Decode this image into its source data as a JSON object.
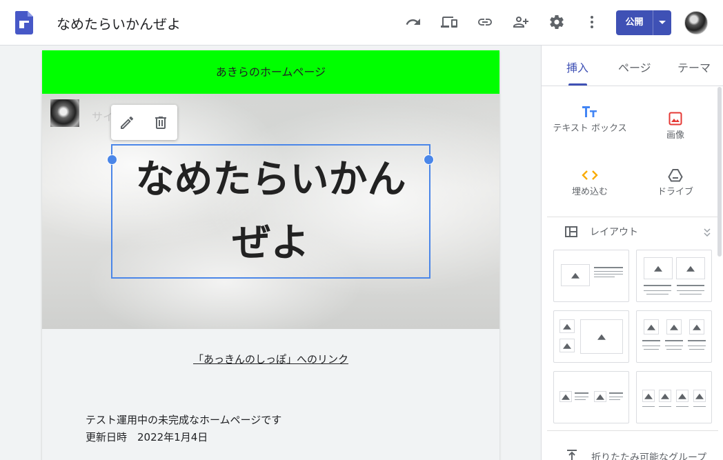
{
  "app": {
    "title": "なめたらいかんぜよ",
    "publish_label": "公開"
  },
  "site": {
    "header_title": "あきらのホームページ",
    "site_name_placeholder": "サイ",
    "hero_title": "なめたらいかんぜよ",
    "link_text": "「あっきんのしっぽ」へのリンク",
    "body_line1": "テスト運用中の未完成なホームページです",
    "body_line2": "更新日時　2022年1月4日"
  },
  "panel": {
    "tabs": [
      "挿入",
      "ページ",
      "テーマ"
    ],
    "insert_items": [
      {
        "label": "テキスト ボックス",
        "icon": "text-box-icon"
      },
      {
        "label": "画像",
        "icon": "image-icon"
      },
      {
        "label": "埋め込む",
        "icon": "embed-icon"
      },
      {
        "label": "ドライブ",
        "icon": "drive-icon"
      }
    ],
    "layout_label": "レイアウト",
    "collapsible_label": "折りたたみ可能なグループ"
  },
  "colors": {
    "accent": "#3f51b5",
    "header_bg": "#00ff00",
    "selection": "#4a86e8",
    "image_icon": "#e53935",
    "embed_icon": "#f9ab00"
  }
}
